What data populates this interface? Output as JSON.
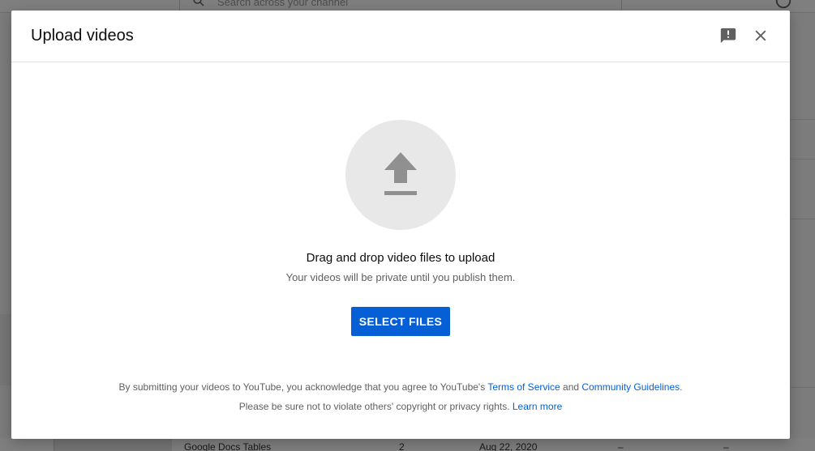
{
  "background": {
    "search_placeholder": "Search across your channel",
    "row": {
      "title": "Google Docs Tables",
      "count": "2",
      "date": "Aug 22, 2020",
      "dash1": "–",
      "dash2": "–"
    }
  },
  "modal": {
    "title": "Upload videos",
    "feedback_icon": "feedback-icon",
    "close_icon": "close-icon",
    "upload_icon": "upload-arrow-icon",
    "drag_text": "Drag and drop video files to upload",
    "private_text": "Your videos will be private until you publish them.",
    "select_button": "SELECT FILES",
    "terms": {
      "prefix": "By submitting your videos to YouTube, you acknowledge that you agree to YouTube's ",
      "tos_link": "Terms of Service",
      "and": " and ",
      "guidelines_link": "Community Guidelines",
      "suffix": ".",
      "line2": "Please be sure not to violate others' copyright or privacy rights. ",
      "learn_more": "Learn more"
    }
  },
  "colors": {
    "accent": "#065fd4",
    "upload_circle": "#e8e8e8",
    "icon_gray": "#909090"
  }
}
